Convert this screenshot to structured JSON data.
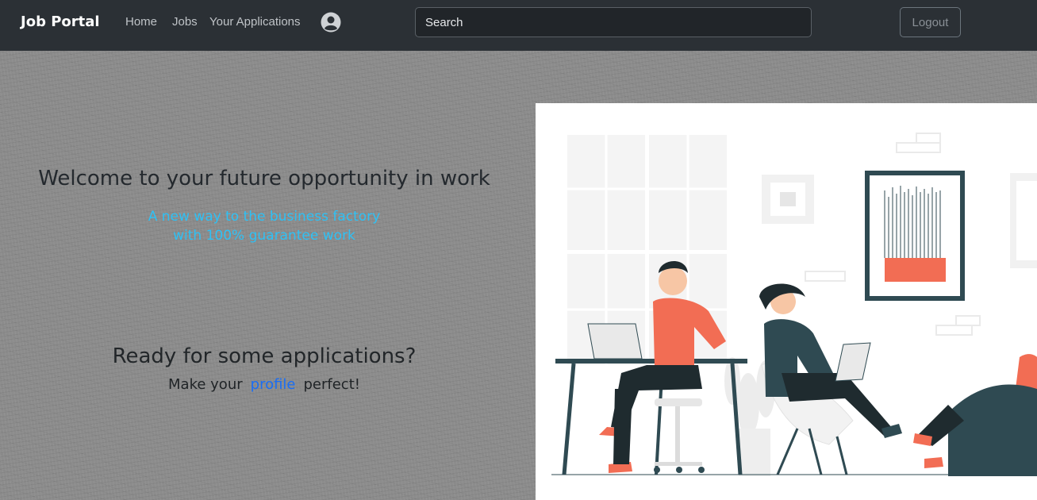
{
  "navbar": {
    "brand": "Job Portal",
    "links": [
      "Home",
      "Jobs",
      "Your Applications"
    ],
    "search_placeholder": "Search",
    "logout_label": "Logout"
  },
  "hero": {
    "welcome": "Welcome to your future opportunity in work",
    "tagline_line1": "A new way to the business factory",
    "tagline_line2": "with 100% guarantee work",
    "ready": "Ready for some applications?",
    "make_prefix": "Make your",
    "make_link": "profile",
    "make_suffix": "perfect!"
  },
  "colors": {
    "navbar_bg": "#2b3035",
    "tagline": "#2ec1f5",
    "link": "#1a6ef5",
    "accent_orange": "#f26d54",
    "dark_teal": "#2f4a52"
  },
  "icons": {
    "avatar": "user-circle-icon"
  }
}
